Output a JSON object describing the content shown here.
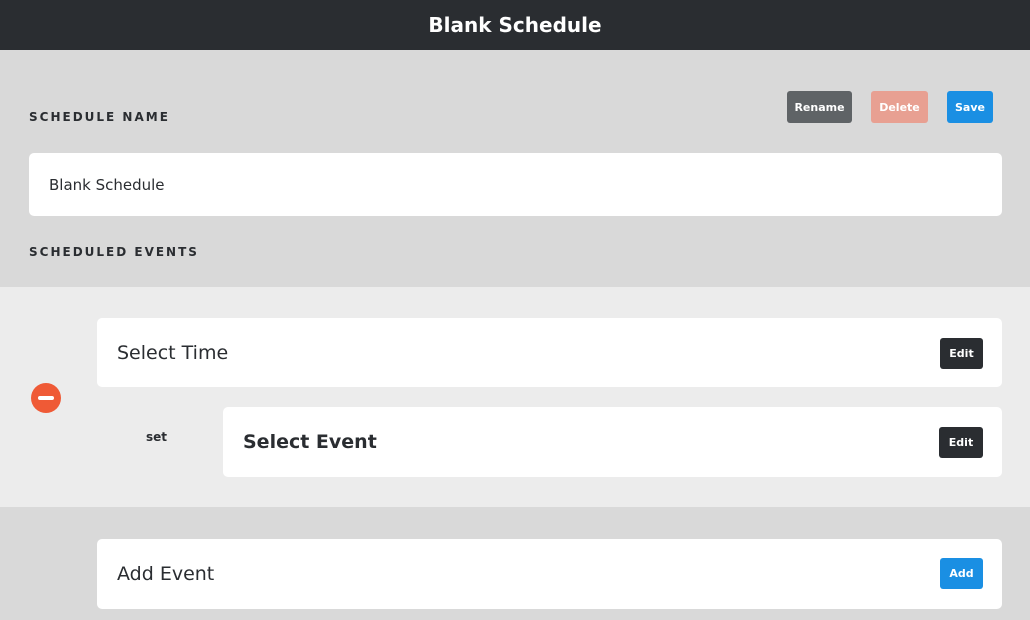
{
  "header": {
    "title": "Blank Schedule"
  },
  "schedule": {
    "name_label": "SCHEDULE NAME",
    "name_value": "Blank Schedule",
    "rename_label": "Rename",
    "delete_label": "Delete",
    "save_label": "Save"
  },
  "events": {
    "section_label": "SCHEDULED EVENTS",
    "items": [
      {
        "time_label": "Select Time",
        "time_edit_label": "Edit",
        "action_label": "set",
        "event_label": "Select Event",
        "event_edit_label": "Edit"
      }
    ]
  },
  "add": {
    "label": "Add Event",
    "button_label": "Add"
  },
  "colors": {
    "header_bg": "#2a2d31",
    "rename": "#5f6366",
    "delete": "#e8a092",
    "save": "#1a8fe3",
    "edit": "#2a2d31",
    "remove": "#ef5a36",
    "add": "#1a8fe3"
  },
  "icons": {
    "remove": "minus-circle-icon"
  }
}
